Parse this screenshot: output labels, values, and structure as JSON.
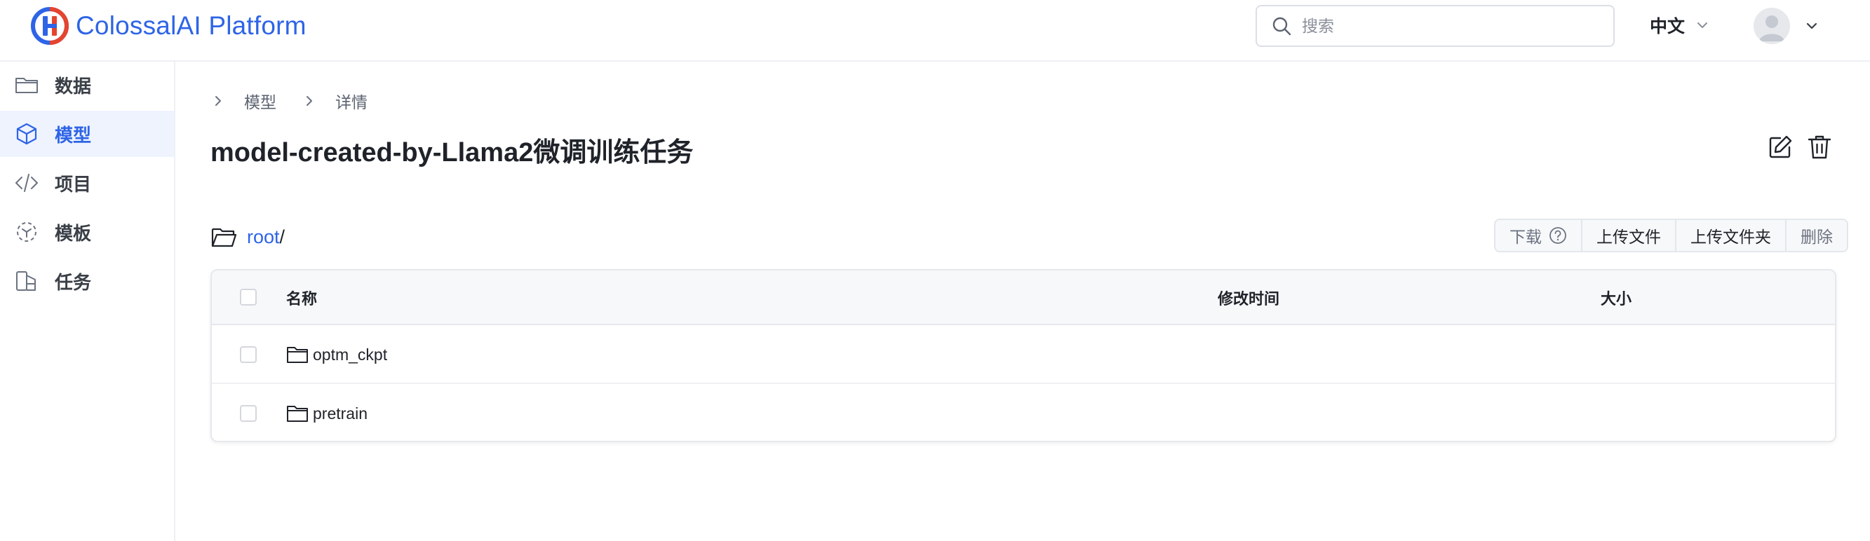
{
  "app": {
    "title": "ColossalAI Platform",
    "brand_color": "#2e64e6",
    "logo_colors": [
      "#2e64e6",
      "#e6442e"
    ]
  },
  "header": {
    "search": {
      "placeholder": "搜索",
      "value": "",
      "icon": "search-icon"
    },
    "language": {
      "label": "中文",
      "icon": "chevron-down-icon"
    },
    "user": {
      "avatar_icon": "avatar-icon",
      "menu_icon": "chevron-down-icon"
    }
  },
  "sidebar": {
    "items": [
      {
        "label": "数据",
        "icon": "folder-icon",
        "active": false
      },
      {
        "label": "模型",
        "icon": "cube-icon",
        "active": true
      },
      {
        "label": "项目",
        "icon": "code-icon",
        "active": false
      },
      {
        "label": "模板",
        "icon": "template-icon",
        "active": false
      },
      {
        "label": "任务",
        "icon": "task-icon",
        "active": false
      }
    ]
  },
  "breadcrumb": {
    "items": [
      {
        "label": "模型",
        "separator_icon": "chevron-right-icon"
      },
      {
        "label": "详情",
        "separator_icon": "chevron-right-icon"
      }
    ]
  },
  "page": {
    "title": "model-created-by-Llama2微调训练任务",
    "actions": [
      {
        "name": "edit",
        "icon": "edit-icon"
      },
      {
        "name": "delete",
        "icon": "trash-icon"
      }
    ]
  },
  "file_browser": {
    "path": {
      "icon": "folder-open-icon",
      "root": "root",
      "separator": "/"
    },
    "buttons": {
      "download": "下载",
      "download_help_icon": "help-circle-icon",
      "upload_file": "上传文件",
      "upload_folder": "上传文件夹",
      "delete": "删除"
    },
    "table": {
      "columns": [
        "名称",
        "修改时间",
        "大小"
      ],
      "rows": [
        {
          "name": "optm_ckpt",
          "type": "folder",
          "modified": "",
          "size": "",
          "icon": "folder-icon"
        },
        {
          "name": "pretrain",
          "type": "folder",
          "modified": "",
          "size": "",
          "icon": "folder-icon"
        }
      ]
    }
  }
}
